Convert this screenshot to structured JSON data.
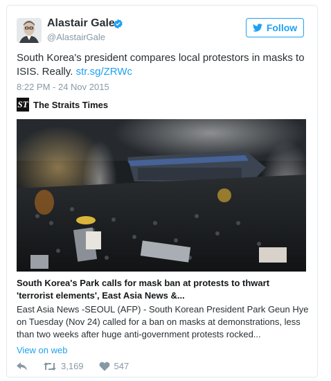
{
  "author": {
    "name": "Alastair Gale",
    "handle": "@AlastairGale"
  },
  "follow_label": "Follow",
  "tweet": {
    "text": "South Korea's president compares local protestors in masks to ISIS. Really.",
    "link": "str.sg/ZRWc",
    "timestamp": "8:22 PM - 24 Nov 2015"
  },
  "card": {
    "source_logo_text": "ST",
    "source_name": "The Straits Times",
    "headline": "South Korea's Park calls for mask ban at protests to thwart 'terrorist elements', East Asia News &...",
    "summary": "East Asia News -SEOUL (AFP) - South Korean President Park Geun Hye on Tuesday (Nov 24) called for a ban on masks at demonstrations, less than two weeks after huge anti-government protests rocked...",
    "view_on_web": "View on web"
  },
  "actions": {
    "retweet_count": "3,169",
    "like_count": "547"
  },
  "colors": {
    "accent": "#1da1f2",
    "muted": "#8899a6",
    "text": "#292f33"
  },
  "icons": [
    "avatar-portrait",
    "verified-badge-icon",
    "twitter-bird-icon",
    "reply-icon",
    "retweet-icon",
    "heart-icon"
  ]
}
